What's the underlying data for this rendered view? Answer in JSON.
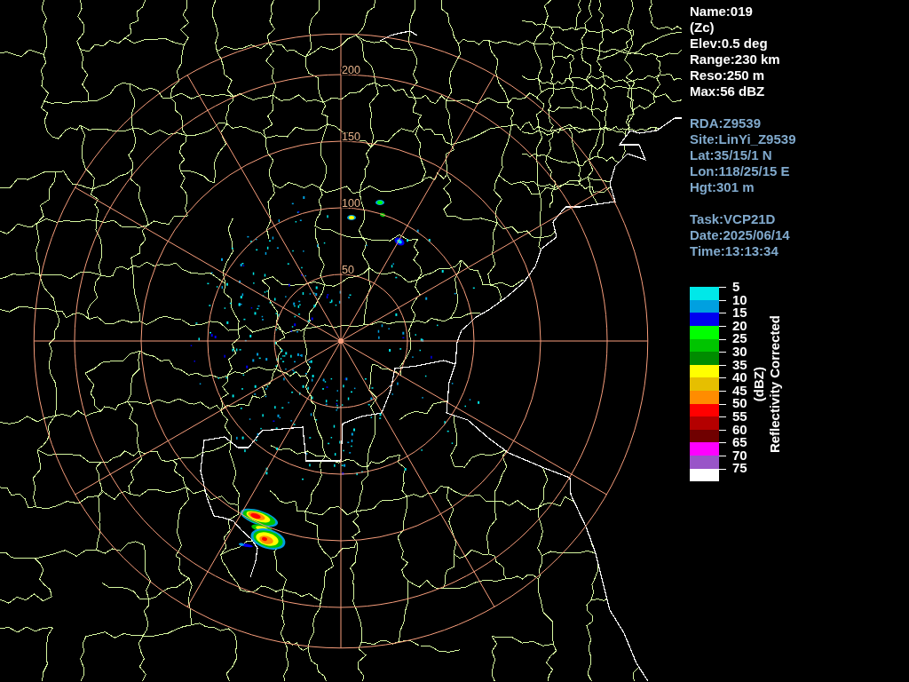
{
  "map": {
    "range_labels": [
      "200",
      "150",
      "100",
      "50"
    ]
  },
  "info_blocks": [
    {
      "kind": "product",
      "lines": [
        "Name:019",
        "(Zc)",
        "Elev:0.5 deg",
        "Range:230 km",
        "Reso:250 m",
        "Max:56 dBZ"
      ]
    },
    {
      "kind": "site",
      "lines": [
        "RDA:Z9539",
        "Site:LinYi_Z9539",
        "Lat:35/15/1 N",
        "Lon:118/25/15 E",
        "Hgt:301 m"
      ]
    },
    {
      "kind": "task",
      "lines": [
        "Task:VCP21D",
        "Date:2025/06/14",
        "Time:13:13:34"
      ]
    }
  ],
  "legend": {
    "unit": "(dBZ)",
    "title": "Reflectivity Corrected",
    "entries": [
      {
        "label": "5",
        "color": "#00e8e8"
      },
      {
        "label": "10",
        "color": "#00a0e0"
      },
      {
        "label": "15",
        "color": "#0000f0"
      },
      {
        "label": "20",
        "color": "#00ff00"
      },
      {
        "label": "25",
        "color": "#00c400"
      },
      {
        "label": "30",
        "color": "#008c00"
      },
      {
        "label": "35",
        "color": "#ffff00"
      },
      {
        "label": "40",
        "color": "#e6bf00"
      },
      {
        "label": "45",
        "color": "#ff8c00"
      },
      {
        "label": "50",
        "color": "#ff0000"
      },
      {
        "label": "55",
        "color": "#b40000"
      },
      {
        "label": "60",
        "color": "#700000"
      },
      {
        "label": "65",
        "color": "#ff00ff"
      },
      {
        "label": "70",
        "color": "#9955c8"
      },
      {
        "label": "75",
        "color": "#ffffff"
      }
    ]
  }
}
